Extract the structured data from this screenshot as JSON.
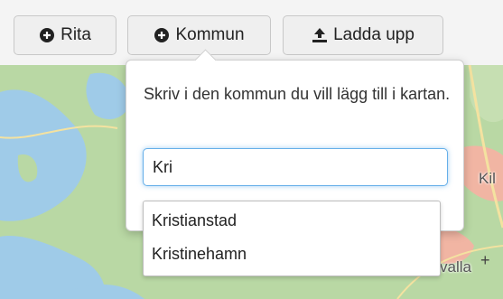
{
  "toolbar": {
    "rita_label": "Rita",
    "kommun_label": "Kommun",
    "ladda_label": "Ladda upp"
  },
  "popover": {
    "text": "Skriv i den kommun du vill lägg till i kartan.",
    "input_value": "Kri"
  },
  "suggestions": {
    "items": [
      "Kristianstad",
      "Kristinehamn"
    ]
  },
  "map": {
    "labels": {
      "kil": "Kil",
      "valla": "valla",
      "cross": "+"
    },
    "colors": {
      "land": "#b9d8a4",
      "water": "#9fcbe8",
      "urban": "#f1b5a3",
      "road": "#f4e2a0"
    }
  },
  "icons": {
    "rita": "plus-circle-icon",
    "kommun": "plus-circle-icon",
    "ladda": "upload-icon"
  }
}
